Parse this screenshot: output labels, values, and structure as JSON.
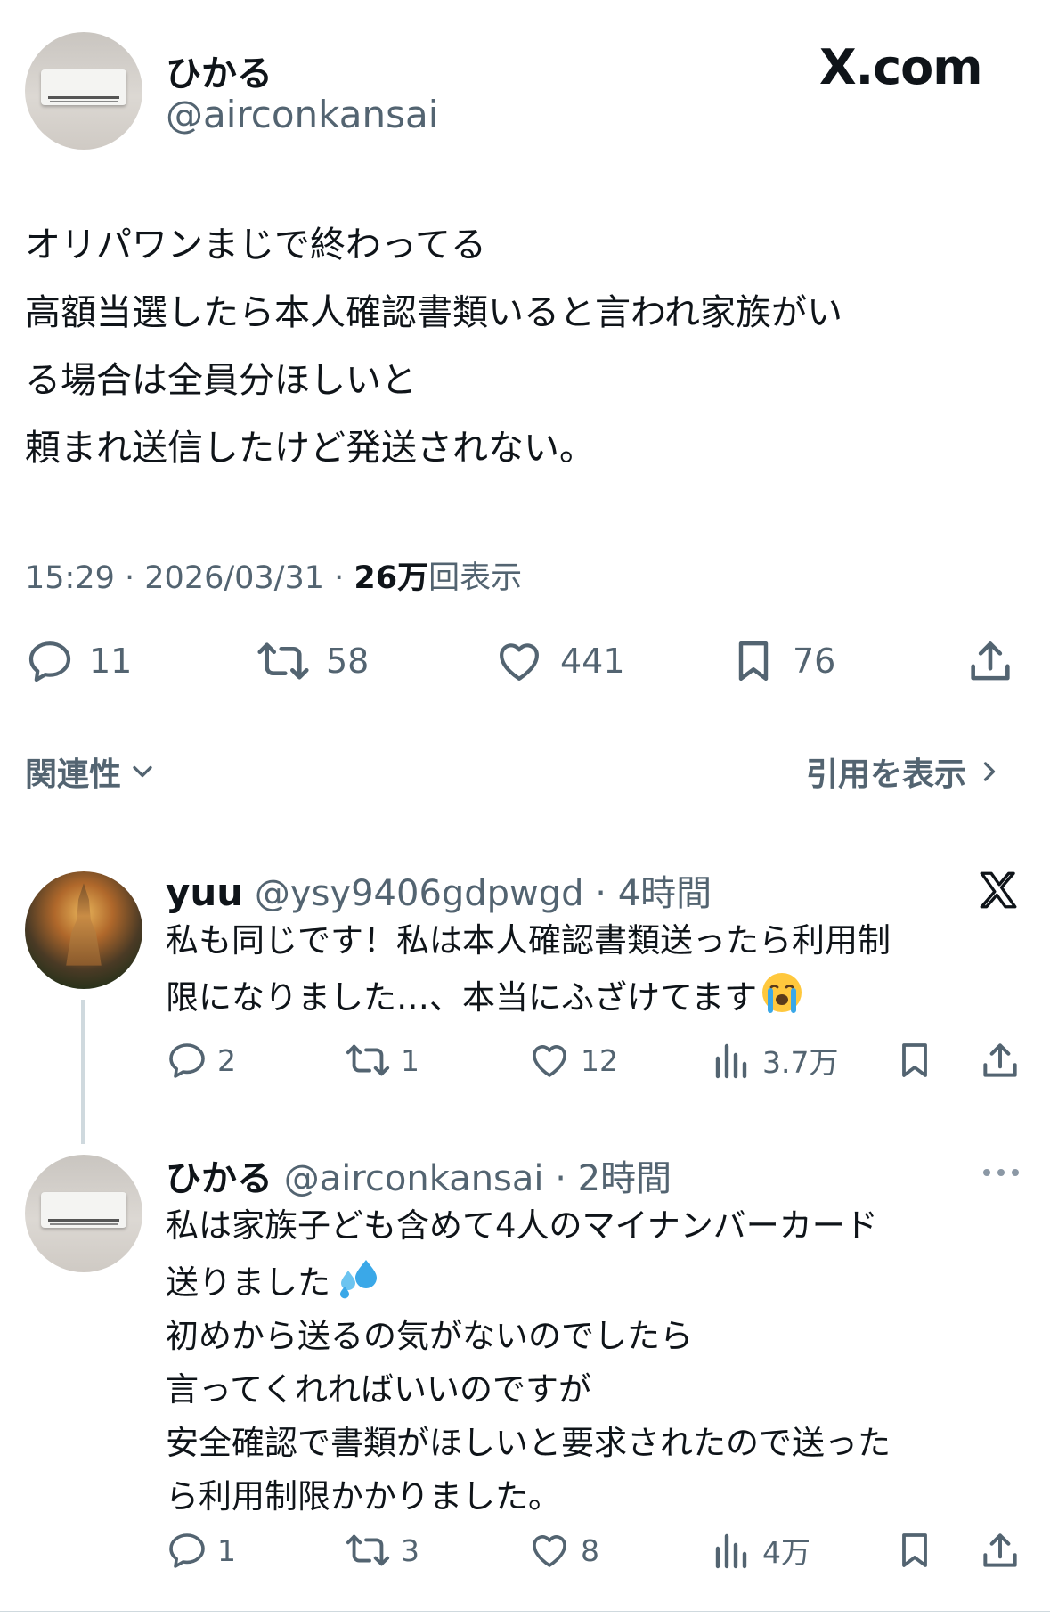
{
  "source_label": "X.com",
  "main_tweet": {
    "name": "ひかる",
    "handle": "@airconkansai",
    "text_lines": [
      "オリパワンまじで終わってる",
      "高額当選したら本人確認書類いると言われ家族がい",
      "る場合は全員分ほしいと",
      "頼まれ送信したけど発送されない。"
    ],
    "time": "15:29",
    "date": "2026/03/31",
    "views_number": "26万",
    "views_label": "回表示",
    "replies": "11",
    "reposts": "58",
    "likes": "441",
    "bookmarks": "76"
  },
  "sort": {
    "label": "関連性",
    "quotes_link": "引用を表示"
  },
  "replies": [
    {
      "name": "yuu",
      "handle": "@ysy9406gdpwgd",
      "time": "4時間",
      "text_line1": "私も同じです！私は本人確認書類送ったら利用制",
      "text_line2": "限になりました…、本当にふざけてます",
      "emoji": "loudly-crying-face",
      "replies": "2",
      "reposts": "1",
      "likes": "12",
      "views": "3.7万"
    },
    {
      "name": "ひかる",
      "handle": "@airconkansai",
      "time": "2時間",
      "text_line1": "私は家族子ども含めて4人のマイナンバーカード",
      "text_line2": "送りました",
      "emoji": "sweat-droplets",
      "text_rest": "初めから送るの気がないのでしたら\n言ってくれればいいのですが\n安全確認で書類がほしいと要求されたので送った\nら利用制限かかりました。",
      "replies": "1",
      "reposts": "3",
      "likes": "8",
      "views": "4万"
    }
  ],
  "colors": {
    "text": "#0f1419",
    "secondary": "#536471",
    "divider": "#cfd9de",
    "emoji_blue": "#3aa8e8"
  }
}
